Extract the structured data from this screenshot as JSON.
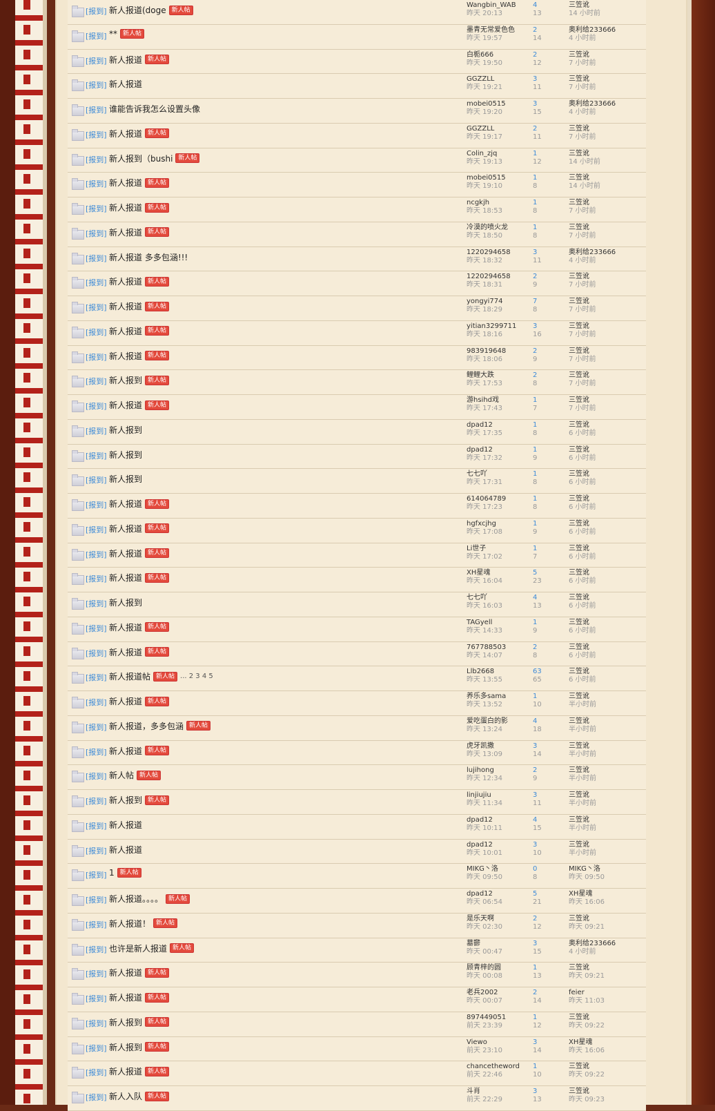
{
  "rows": [
    {
      "cat": "[报到]",
      "title": "新人报道(doge",
      "badge": "新人帖",
      "pages": "",
      "author": "Wangbin_WAB",
      "time": "昨天 20:13",
      "replies": "4",
      "views": "13",
      "last": "三笠讹",
      "last_time": "14 小时前"
    },
    {
      "cat": "[报到]",
      "title": "**",
      "badge": "新人帖",
      "pages": "",
      "author": "墨青无常爱色色",
      "time": "昨天 19:57",
      "replies": "2",
      "views": "14",
      "last": "奥利给233666",
      "last_time": "4 小时前"
    },
    {
      "cat": "[报到]",
      "title": "新人报道",
      "badge": "新人帖",
      "pages": "",
      "author": "白栀666",
      "time": "昨天 19:50",
      "replies": "2",
      "views": "12",
      "last": "三笠讹",
      "last_time": "7 小时前"
    },
    {
      "cat": "[报到]",
      "title": "新人报道",
      "badge": "",
      "pages": "",
      "author": "GGZZLL",
      "time": "昨天 19:21",
      "replies": "3",
      "views": "11",
      "last": "三笠讹",
      "last_time": "7 小时前"
    },
    {
      "cat": "[报到]",
      "title": "谁能告诉我怎么设置头像",
      "badge": "",
      "pages": "",
      "author": "mobei0515",
      "time": "昨天 19:20",
      "replies": "3",
      "views": "15",
      "last": "奥利给233666",
      "last_time": "4 小时前"
    },
    {
      "cat": "[报到]",
      "title": "新人报道",
      "badge": "新人帖",
      "pages": "",
      "author": "GGZZLL",
      "time": "昨天 19:17",
      "replies": "2",
      "views": "11",
      "last": "三笠讹",
      "last_time": "7 小时前"
    },
    {
      "cat": "[报到]",
      "title": "新人报到（bushi",
      "badge": "新人帖",
      "pages": "",
      "author": "Colin_zjq",
      "time": "昨天 19:13",
      "replies": "1",
      "views": "12",
      "last": "三笠讹",
      "last_time": "14 小时前"
    },
    {
      "cat": "[报到]",
      "title": "新人报道",
      "badge": "新人帖",
      "pages": "",
      "author": "mobei0515",
      "time": "昨天 19:10",
      "replies": "1",
      "views": "8",
      "last": "三笠讹",
      "last_time": "14 小时前"
    },
    {
      "cat": "[报到]",
      "title": "新人报道",
      "badge": "新人帖",
      "pages": "",
      "author": "ncgkjh",
      "time": "昨天 18:53",
      "replies": "1",
      "views": "8",
      "last": "三笠讹",
      "last_time": "7 小时前"
    },
    {
      "cat": "[报到]",
      "title": "新人报道",
      "badge": "新人帖",
      "pages": "",
      "author": "冷漠的喷火龙",
      "time": "昨天 18:50",
      "replies": "1",
      "views": "8",
      "last": "三笠讹",
      "last_time": "7 小时前"
    },
    {
      "cat": "[报到]",
      "title": "新人报道 多多包涵!!!",
      "badge": "",
      "pages": "",
      "author": "1220294658",
      "time": "昨天 18:32",
      "replies": "3",
      "views": "11",
      "last": "奥利给233666",
      "last_time": "4 小时前"
    },
    {
      "cat": "[报到]",
      "title": "新人报道",
      "badge": "新人帖",
      "pages": "",
      "author": "1220294658",
      "time": "昨天 18:31",
      "replies": "2",
      "views": "9",
      "last": "三笠讹",
      "last_time": "7 小时前"
    },
    {
      "cat": "[报到]",
      "title": "新人报道",
      "badge": "新人帖",
      "pages": "",
      "author": "yongyi774",
      "time": "昨天 18:29",
      "replies": "7",
      "views": "8",
      "last": "三笠讹",
      "last_time": "7 小时前"
    },
    {
      "cat": "[报到]",
      "title": "新人报道",
      "badge": "新人帖",
      "pages": "",
      "author": "yitian3299711",
      "time": "昨天 18:16",
      "replies": "3",
      "views": "16",
      "last": "三笠讹",
      "last_time": "7 小时前"
    },
    {
      "cat": "[报到]",
      "title": "新人报道",
      "badge": "新人帖",
      "pages": "",
      "author": "983919648",
      "time": "昨天 18:06",
      "replies": "2",
      "views": "9",
      "last": "三笠讹",
      "last_time": "7 小时前"
    },
    {
      "cat": "[报到]",
      "title": "新人报到",
      "badge": "新人帖",
      "pages": "",
      "author": "鲤鲤大跌",
      "time": "昨天 17:53",
      "replies": "2",
      "views": "8",
      "last": "三笠讹",
      "last_time": "7 小时前"
    },
    {
      "cat": "[报到]",
      "title": "新人报道",
      "badge": "新人帖",
      "pages": "",
      "author": "游hsihd戏",
      "time": "昨天 17:43",
      "replies": "1",
      "views": "7",
      "last": "三笠讹",
      "last_time": "7 小时前"
    },
    {
      "cat": "[报到]",
      "title": "新人报到",
      "badge": "",
      "pages": "",
      "author": "dpad12",
      "time": "昨天 17:35",
      "replies": "1",
      "views": "8",
      "last": "三笠讹",
      "last_time": "6 小时前"
    },
    {
      "cat": "[报到]",
      "title": "新人报到",
      "badge": "",
      "pages": "",
      "author": "dpad12",
      "time": "昨天 17:32",
      "replies": "1",
      "views": "9",
      "last": "三笠讹",
      "last_time": "6 小时前"
    },
    {
      "cat": "[报到]",
      "title": "新人报到",
      "badge": "",
      "pages": "",
      "author": "七七吖",
      "time": "昨天 17:31",
      "replies": "1",
      "views": "8",
      "last": "三笠讹",
      "last_time": "6 小时前"
    },
    {
      "cat": "[报到]",
      "title": "新人报道",
      "badge": "新人帖",
      "pages": "",
      "author": "614064789",
      "time": "昨天 17:23",
      "replies": "1",
      "views": "8",
      "last": "三笠讹",
      "last_time": "6 小时前"
    },
    {
      "cat": "[报到]",
      "title": "新人报道",
      "badge": "新人帖",
      "pages": "",
      "author": "hgfxcjhg",
      "time": "昨天 17:08",
      "replies": "1",
      "views": "9",
      "last": "三笠讹",
      "last_time": "6 小时前"
    },
    {
      "cat": "[报到]",
      "title": "新人报道",
      "badge": "新人帖",
      "pages": "",
      "author": "Li世子",
      "time": "昨天 17:02",
      "replies": "1",
      "views": "7",
      "last": "三笠讹",
      "last_time": "6 小时前"
    },
    {
      "cat": "[报到]",
      "title": "新人报道",
      "badge": "新人帖",
      "pages": "",
      "author": "XH星魂",
      "time": "昨天 16:04",
      "replies": "5",
      "views": "23",
      "last": "三笠讹",
      "last_time": "6 小时前"
    },
    {
      "cat": "[报到]",
      "title": "新人报到",
      "badge": "",
      "pages": "",
      "author": "七七吖",
      "time": "昨天 16:03",
      "replies": "4",
      "views": "13",
      "last": "三笠讹",
      "last_time": "6 小时前"
    },
    {
      "cat": "[报到]",
      "title": "新人报道",
      "badge": "新人帖",
      "pages": "",
      "author": "TAGyell",
      "time": "昨天 14:33",
      "replies": "1",
      "views": "9",
      "last": "三笠讹",
      "last_time": "6 小时前"
    },
    {
      "cat": "[报到]",
      "title": "新人报道",
      "badge": "新人帖",
      "pages": "",
      "author": "767788503",
      "time": "昨天 14:07",
      "replies": "2",
      "views": "8",
      "last": "三笠讹",
      "last_time": "6 小时前"
    },
    {
      "cat": "[报到]",
      "title": "新人报道帖",
      "badge": "新人帖",
      "pages": "... 2 3 4 5",
      "author": "Llb2668",
      "time": "昨天 13:55",
      "replies": "63",
      "views": "65",
      "last": "三笠讹",
      "last_time": "6 小时前"
    },
    {
      "cat": "[报到]",
      "title": "新人报道",
      "badge": "新人帖",
      "pages": "",
      "author": "养乐多sama",
      "time": "昨天 13:52",
      "replies": "1",
      "views": "10",
      "last": "三笠讹",
      "last_time": "半小时前"
    },
    {
      "cat": "[报到]",
      "title": "新人报道，多多包涵",
      "badge": "新人帖",
      "pages": "",
      "author": "爱吃蛋白的影",
      "time": "昨天 13:24",
      "replies": "4",
      "views": "18",
      "last": "三笠讹",
      "last_time": "半小时前"
    },
    {
      "cat": "[报到]",
      "title": "新人报道",
      "badge": "新人帖",
      "pages": "",
      "author": "虎牙凯撒",
      "time": "昨天 13:09",
      "replies": "3",
      "views": "14",
      "last": "三笠讹",
      "last_time": "半小时前"
    },
    {
      "cat": "[报到]",
      "title": "新人帖",
      "badge": "新人帖",
      "pages": "",
      "author": "lujihong",
      "time": "昨天 12:34",
      "replies": "2",
      "views": "9",
      "last": "三笠讹",
      "last_time": "半小时前"
    },
    {
      "cat": "[报到]",
      "title": "新人报到",
      "badge": "新人帖",
      "pages": "",
      "author": "linjiujiu",
      "time": "昨天 11:34",
      "replies": "3",
      "views": "11",
      "last": "三笠讹",
      "last_time": "半小时前"
    },
    {
      "cat": "[报到]",
      "title": "新人报道",
      "badge": "",
      "pages": "",
      "author": "dpad12",
      "time": "昨天 10:11",
      "replies": "4",
      "views": "15",
      "last": "三笠讹",
      "last_time": "半小时前"
    },
    {
      "cat": "[报到]",
      "title": "新人报道",
      "badge": "",
      "pages": "",
      "author": "dpad12",
      "time": "昨天 10:01",
      "replies": "3",
      "views": "10",
      "last": "三笠讹",
      "last_time": "半小时前"
    },
    {
      "cat": "[报到]",
      "title": "1",
      "badge": "新人帖",
      "pages": "",
      "author": "MIKG丶洛",
      "time": "昨天 09:50",
      "replies": "0",
      "views": "8",
      "last": "MIKG丶洛",
      "last_time": "昨天 09:50"
    },
    {
      "cat": "[报到]",
      "title": "新人报道。。。。",
      "badge": "新人帖",
      "pages": "",
      "author": "dpad12",
      "time": "昨天 06:54",
      "replies": "5",
      "views": "21",
      "last": "XH星魂",
      "last_time": "昨天 16:06"
    },
    {
      "cat": "[报到]",
      "title": "新人报道！",
      "badge": "新人帖",
      "pages": "",
      "author": "是乐天啊",
      "time": "昨天 02:30",
      "replies": "2",
      "views": "12",
      "last": "三笠讹",
      "last_time": "昨天 09:21"
    },
    {
      "cat": "[报到]",
      "title": "也许是新人报道",
      "badge": "新人帖",
      "pages": "",
      "author": "墓鬱",
      "time": "昨天 00:47",
      "replies": "3",
      "views": "15",
      "last": "奥利给233666",
      "last_time": "4 小时前"
    },
    {
      "cat": "[报到]",
      "title": "新人报道",
      "badge": "新人帖",
      "pages": "",
      "author": "顾青梓的圆",
      "time": "昨天 00:08",
      "replies": "1",
      "views": "13",
      "last": "三笠讹",
      "last_time": "昨天 09:21"
    },
    {
      "cat": "[报到]",
      "title": "新人报道",
      "badge": "新人帖",
      "pages": "",
      "author": "老兵2002",
      "time": "昨天 00:07",
      "replies": "2",
      "views": "14",
      "last": "feier",
      "last_time": "昨天 11:03"
    },
    {
      "cat": "[报到]",
      "title": "新人报到",
      "badge": "新人帖",
      "pages": "",
      "author": "897449051",
      "time": "前天 23:39",
      "replies": "1",
      "views": "12",
      "last": "三笠讹",
      "last_time": "昨天 09:22"
    },
    {
      "cat": "[报到]",
      "title": "新人报到",
      "badge": "新人帖",
      "pages": "",
      "author": "Viewo",
      "time": "前天 23:10",
      "replies": "3",
      "views": "14",
      "last": "XH星魂",
      "last_time": "昨天 16:06"
    },
    {
      "cat": "[报到]",
      "title": "新人报道",
      "badge": "新人帖",
      "pages": "",
      "author": "chancetheword",
      "time": "前天 22:46",
      "replies": "1",
      "views": "10",
      "last": "三笠讹",
      "last_time": "昨天 09:22"
    },
    {
      "cat": "[报到]",
      "title": "新人入队",
      "badge": "新人帖",
      "pages": "",
      "author": "斗肖",
      "time": "前天 22:29",
      "replies": "3",
      "views": "13",
      "last": "三笠讹",
      "last_time": "昨天 09:23"
    }
  ]
}
